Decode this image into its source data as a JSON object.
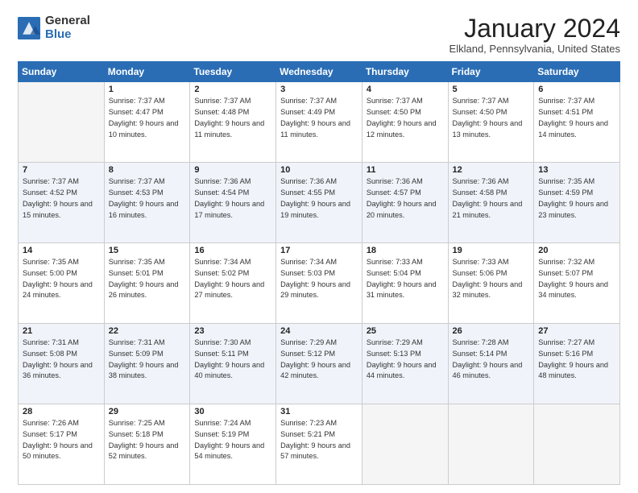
{
  "header": {
    "logo_general": "General",
    "logo_blue": "Blue",
    "title": "January 2024",
    "location": "Elkland, Pennsylvania, United States"
  },
  "days_of_week": [
    "Sunday",
    "Monday",
    "Tuesday",
    "Wednesday",
    "Thursday",
    "Friday",
    "Saturday"
  ],
  "weeks": [
    [
      {
        "day": "",
        "empty": true
      },
      {
        "day": "1",
        "sunrise": "7:37 AM",
        "sunset": "4:47 PM",
        "daylight": "9 hours and 10 minutes."
      },
      {
        "day": "2",
        "sunrise": "7:37 AM",
        "sunset": "4:48 PM",
        "daylight": "9 hours and 11 minutes."
      },
      {
        "day": "3",
        "sunrise": "7:37 AM",
        "sunset": "4:49 PM",
        "daylight": "9 hours and 11 minutes."
      },
      {
        "day": "4",
        "sunrise": "7:37 AM",
        "sunset": "4:50 PM",
        "daylight": "9 hours and 12 minutes."
      },
      {
        "day": "5",
        "sunrise": "7:37 AM",
        "sunset": "4:50 PM",
        "daylight": "9 hours and 13 minutes."
      },
      {
        "day": "6",
        "sunrise": "7:37 AM",
        "sunset": "4:51 PM",
        "daylight": "9 hours and 14 minutes."
      }
    ],
    [
      {
        "day": "7",
        "sunrise": "7:37 AM",
        "sunset": "4:52 PM",
        "daylight": "9 hours and 15 minutes."
      },
      {
        "day": "8",
        "sunrise": "7:37 AM",
        "sunset": "4:53 PM",
        "daylight": "9 hours and 16 minutes."
      },
      {
        "day": "9",
        "sunrise": "7:36 AM",
        "sunset": "4:54 PM",
        "daylight": "9 hours and 17 minutes."
      },
      {
        "day": "10",
        "sunrise": "7:36 AM",
        "sunset": "4:55 PM",
        "daylight": "9 hours and 19 minutes."
      },
      {
        "day": "11",
        "sunrise": "7:36 AM",
        "sunset": "4:57 PM",
        "daylight": "9 hours and 20 minutes."
      },
      {
        "day": "12",
        "sunrise": "7:36 AM",
        "sunset": "4:58 PM",
        "daylight": "9 hours and 21 minutes."
      },
      {
        "day": "13",
        "sunrise": "7:35 AM",
        "sunset": "4:59 PM",
        "daylight": "9 hours and 23 minutes."
      }
    ],
    [
      {
        "day": "14",
        "sunrise": "7:35 AM",
        "sunset": "5:00 PM",
        "daylight": "9 hours and 24 minutes."
      },
      {
        "day": "15",
        "sunrise": "7:35 AM",
        "sunset": "5:01 PM",
        "daylight": "9 hours and 26 minutes."
      },
      {
        "day": "16",
        "sunrise": "7:34 AM",
        "sunset": "5:02 PM",
        "daylight": "9 hours and 27 minutes."
      },
      {
        "day": "17",
        "sunrise": "7:34 AM",
        "sunset": "5:03 PM",
        "daylight": "9 hours and 29 minutes."
      },
      {
        "day": "18",
        "sunrise": "7:33 AM",
        "sunset": "5:04 PM",
        "daylight": "9 hours and 31 minutes."
      },
      {
        "day": "19",
        "sunrise": "7:33 AM",
        "sunset": "5:06 PM",
        "daylight": "9 hours and 32 minutes."
      },
      {
        "day": "20",
        "sunrise": "7:32 AM",
        "sunset": "5:07 PM",
        "daylight": "9 hours and 34 minutes."
      }
    ],
    [
      {
        "day": "21",
        "sunrise": "7:31 AM",
        "sunset": "5:08 PM",
        "daylight": "9 hours and 36 minutes."
      },
      {
        "day": "22",
        "sunrise": "7:31 AM",
        "sunset": "5:09 PM",
        "daylight": "9 hours and 38 minutes."
      },
      {
        "day": "23",
        "sunrise": "7:30 AM",
        "sunset": "5:11 PM",
        "daylight": "9 hours and 40 minutes."
      },
      {
        "day": "24",
        "sunrise": "7:29 AM",
        "sunset": "5:12 PM",
        "daylight": "9 hours and 42 minutes."
      },
      {
        "day": "25",
        "sunrise": "7:29 AM",
        "sunset": "5:13 PM",
        "daylight": "9 hours and 44 minutes."
      },
      {
        "day": "26",
        "sunrise": "7:28 AM",
        "sunset": "5:14 PM",
        "daylight": "9 hours and 46 minutes."
      },
      {
        "day": "27",
        "sunrise": "7:27 AM",
        "sunset": "5:16 PM",
        "daylight": "9 hours and 48 minutes."
      }
    ],
    [
      {
        "day": "28",
        "sunrise": "7:26 AM",
        "sunset": "5:17 PM",
        "daylight": "9 hours and 50 minutes."
      },
      {
        "day": "29",
        "sunrise": "7:25 AM",
        "sunset": "5:18 PM",
        "daylight": "9 hours and 52 minutes."
      },
      {
        "day": "30",
        "sunrise": "7:24 AM",
        "sunset": "5:19 PM",
        "daylight": "9 hours and 54 minutes."
      },
      {
        "day": "31",
        "sunrise": "7:23 AM",
        "sunset": "5:21 PM",
        "daylight": "9 hours and 57 minutes."
      },
      {
        "day": "",
        "empty": true
      },
      {
        "day": "",
        "empty": true
      },
      {
        "day": "",
        "empty": true
      }
    ]
  ],
  "labels": {
    "sunrise": "Sunrise:",
    "sunset": "Sunset:",
    "daylight": "Daylight:"
  }
}
